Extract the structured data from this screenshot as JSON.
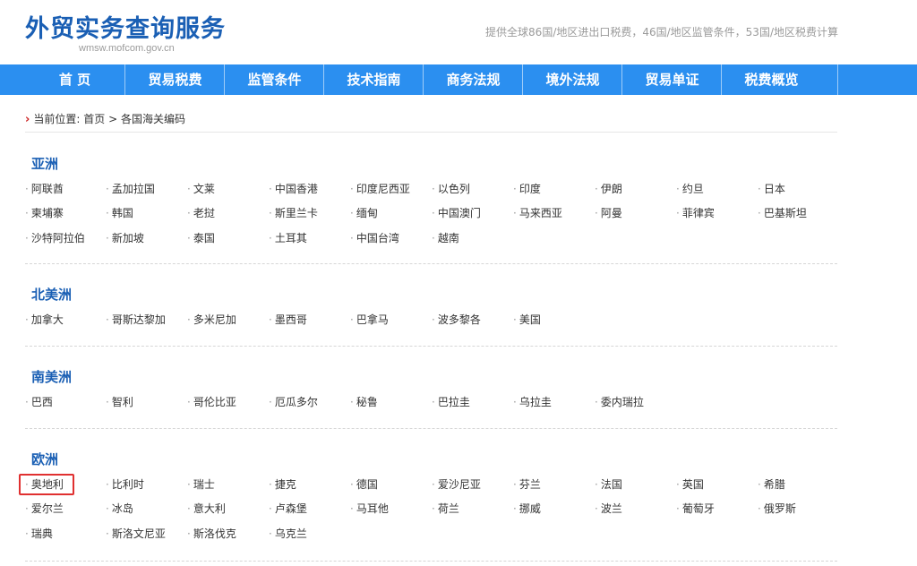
{
  "header": {
    "title": "外贸实务查询服务",
    "domain": "wmsw.mofcom.gov.cn",
    "tagline": "提供全球86国/地区进出口税费，46国/地区监管条件，53国/地区税费计算"
  },
  "nav": [
    "首 页",
    "贸易税费",
    "监管条件",
    "技术指南",
    "商务法规",
    "境外法规",
    "贸易单证",
    "税费概览"
  ],
  "breadcrumb": {
    "prefix": "当前位置:",
    "home": "首页",
    "separator": ">",
    "current": "各国海关编码"
  },
  "regions": [
    {
      "title": "亚洲",
      "countries": [
        "阿联酋",
        "孟加拉国",
        "文莱",
        "中国香港",
        "印度尼西亚",
        "以色列",
        "印度",
        "伊朗",
        "约旦",
        "日本",
        "柬埔寨",
        "韩国",
        "老挝",
        "斯里兰卡",
        "缅甸",
        "中国澳门",
        "马来西亚",
        "阿曼",
        "菲律宾",
        "巴基斯坦",
        "沙特阿拉伯",
        "新加坡",
        "泰国",
        "土耳其",
        "中国台湾",
        "越南"
      ]
    },
    {
      "title": "北美洲",
      "countries": [
        "加拿大",
        "哥斯达黎加",
        "多米尼加",
        "墨西哥",
        "巴拿马",
        "波多黎各",
        "美国"
      ]
    },
    {
      "title": "南美洲",
      "countries": [
        "巴西",
        "智利",
        "哥伦比亚",
        "厄瓜多尔",
        "秘鲁",
        "巴拉圭",
        "乌拉圭",
        "委内瑞拉"
      ]
    },
    {
      "title": "欧洲",
      "countries": [
        "奥地利",
        "比利时",
        "瑞士",
        "捷克",
        "德国",
        "爱沙尼亚",
        "芬兰",
        "法国",
        "英国",
        "希腊",
        "爱尔兰",
        "冰岛",
        "意大利",
        "卢森堡",
        "马耳他",
        "荷兰",
        "挪威",
        "波兰",
        "葡萄牙",
        "俄罗斯",
        "瑞典",
        "斯洛文尼亚",
        "斯洛伐克",
        "乌克兰"
      ]
    }
  ],
  "colors": {
    "nav_bg": "#2b8ff0",
    "title": "#1a5fb4",
    "highlight": "#e03030"
  }
}
